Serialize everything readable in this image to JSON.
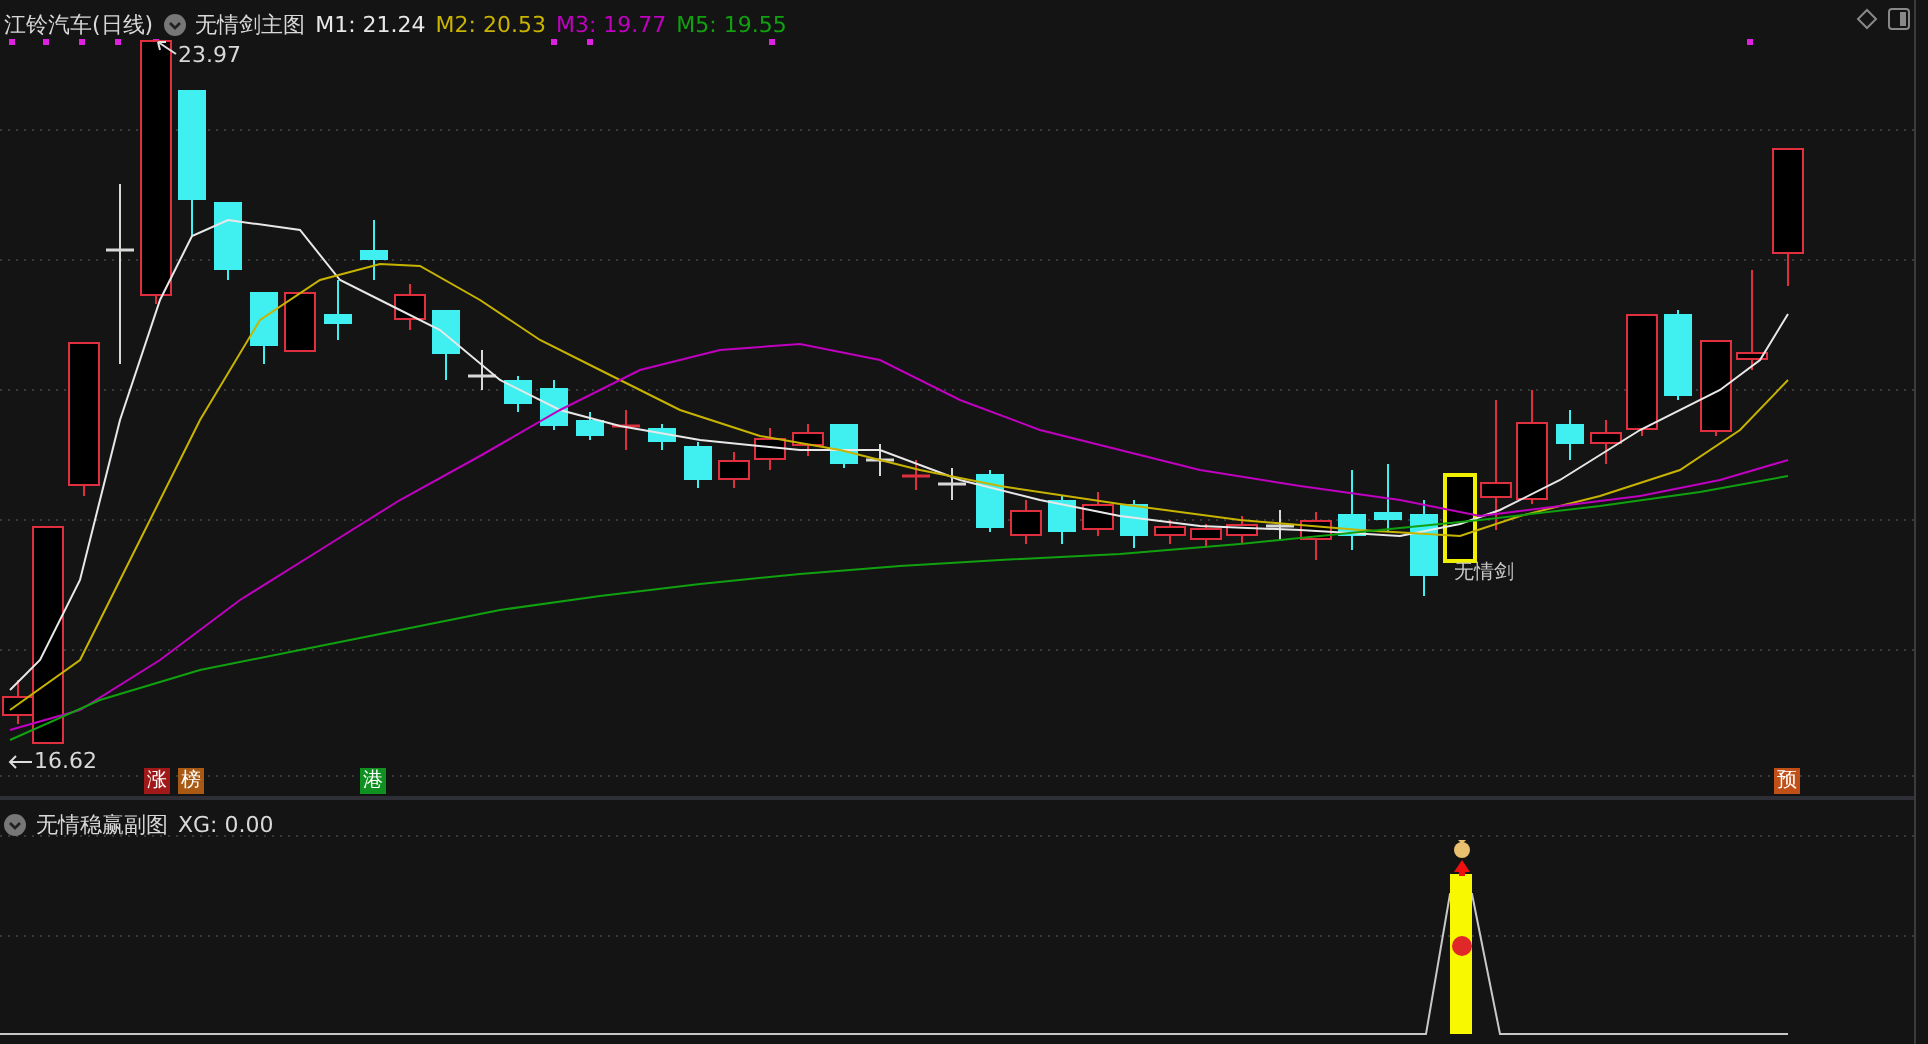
{
  "main_chart": {
    "stock_title": "江铃汽车(日线)",
    "indicator_name": "无情剑主图",
    "moving_averages": [
      {
        "label": "M1: 21.24",
        "color": "#e8e8e8"
      },
      {
        "label": "M2: 20.53",
        "color": "#c8b400"
      },
      {
        "label": "M3: 19.77",
        "color": "#c000c0"
      },
      {
        "label": "M5: 19.55",
        "color": "#10a010"
      }
    ],
    "high_label": "23.97",
    "low_label": "16.62",
    "signal_label": "无情剑",
    "badges": [
      {
        "text": "涨",
        "color": "#a01818"
      },
      {
        "text": "榜",
        "color": "#a85a14"
      },
      {
        "text": "港",
        "color": "#109020"
      },
      {
        "text": "预",
        "color": "#c05018"
      }
    ]
  },
  "sub_chart": {
    "indicator_name": "无情稳赢副图",
    "reading": "XG: 0.00"
  }
}
